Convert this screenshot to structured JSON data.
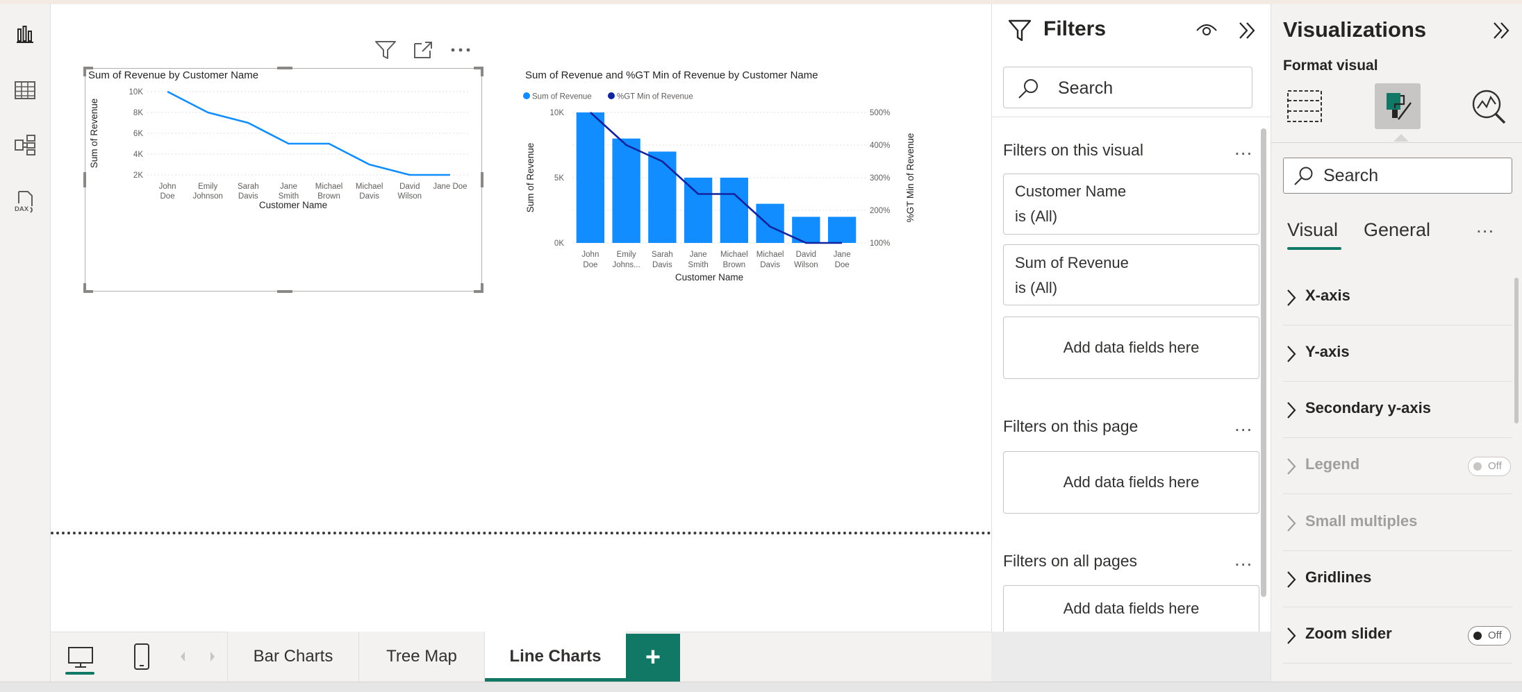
{
  "visual1": {
    "title": "Sum of Revenue by Customer Name",
    "y_ticks": [
      "10K",
      "8K",
      "6K",
      "4K",
      "2K"
    ],
    "x_lines": [
      [
        "John",
        "Doe"
      ],
      [
        "Emily",
        "Johnson"
      ],
      [
        "Sarah",
        "Davis"
      ],
      [
        "Jane",
        "Smith"
      ],
      [
        "Michael",
        "Brown"
      ],
      [
        "Michael",
        "Davis"
      ],
      [
        "David",
        "Wilson"
      ],
      [
        "Jane Doe",
        ""
      ]
    ],
    "xlabel": "Customer Name",
    "ylabel": "Sum of Revenue"
  },
  "visual2": {
    "title": "Sum of Revenue and %GT Min of Revenue by Customer Name",
    "legend": [
      "Sum of Revenue",
      "%GT Min of Revenue"
    ],
    "y_ticks": [
      "10K",
      "5K",
      "0K"
    ],
    "y2_ticks": [
      "500%",
      "400%",
      "300%",
      "200%",
      "100%"
    ],
    "x_lines": [
      [
        "John",
        "Doe"
      ],
      [
        "Emily",
        "Johns..."
      ],
      [
        "Sarah",
        "Davis"
      ],
      [
        "Jane",
        "Smith"
      ],
      [
        "Michael",
        "Brown"
      ],
      [
        "Michael",
        "Davis"
      ],
      [
        "David",
        "Wilson"
      ],
      [
        "Jane",
        "Doe"
      ]
    ],
    "xlabel": "Customer Name",
    "ylabel": "Sum of Revenue",
    "y2label": "%GT Min of Revenue"
  },
  "chart_data": [
    {
      "type": "line",
      "title": "Sum of Revenue by Customer Name",
      "categories": [
        "John Doe",
        "Emily Johnson",
        "Sarah Davis",
        "Jane Smith",
        "Michael Brown",
        "Michael Davis",
        "David Wilson",
        "Jane Doe"
      ],
      "series": [
        {
          "name": "Sum of Revenue",
          "values": [
            10000,
            8000,
            7000,
            5000,
            5000,
            3000,
            2000,
            2000
          ]
        }
      ],
      "xlabel": "Customer Name",
      "ylabel": "Sum of Revenue",
      "ylim": [
        2000,
        10000
      ],
      "grid": true,
      "color": "#118dff"
    },
    {
      "type": "bar",
      "title": "Sum of Revenue and %GT Min of Revenue by Customer Name",
      "categories": [
        "John Doe",
        "Emily Johns...",
        "Sarah Davis",
        "Jane Smith",
        "Michael Brown",
        "Michael Davis",
        "David Wilson",
        "Jane Doe"
      ],
      "series": [
        {
          "name": "Sum of Revenue",
          "type": "bar",
          "values": [
            10000,
            8000,
            7000,
            5000,
            5000,
            3000,
            2000,
            2000
          ],
          "color": "#118dff"
        },
        {
          "name": "%GT Min of Revenue",
          "type": "line",
          "axis": "secondary",
          "values": [
            500,
            400,
            350,
            250,
            250,
            150,
            100,
            100
          ],
          "color": "#12239e"
        }
      ],
      "xlabel": "Customer Name",
      "ylabel": "Sum of Revenue",
      "y2label": "%GT Min of Revenue",
      "ylim": [
        0,
        10000
      ],
      "y2lim": [
        100,
        500
      ],
      "legend": "top-left",
      "grid": true
    }
  ],
  "filters": {
    "title": "Filters",
    "search_placeholder": "Search",
    "on_visual_label": "Filters on this visual",
    "on_page_label": "Filters on this page",
    "on_all_label": "Filters on all pages",
    "more": "...",
    "cards": [
      {
        "field": "Customer Name",
        "state": "is (All)"
      },
      {
        "field": "Sum of Revenue",
        "state": "is (All)"
      }
    ],
    "add_fields": "Add data fields here"
  },
  "viz": {
    "title": "Visualizations",
    "format_label": "Format visual",
    "search_placeholder": "Search",
    "tab_visual": "Visual",
    "tab_general": "General",
    "more": "...",
    "sections": [
      {
        "label": "X-axis"
      },
      {
        "label": "Y-axis"
      },
      {
        "label": "Secondary y-axis"
      },
      {
        "label": "Legend",
        "toggle": "Off",
        "disabled": true
      },
      {
        "label": "Small multiples",
        "disabled": true
      },
      {
        "label": "Gridlines"
      },
      {
        "label": "Zoom slider",
        "toggle": "Off"
      }
    ]
  },
  "pages": {
    "tabs": [
      "Bar Charts",
      "Tree Map",
      "Line Charts"
    ],
    "active": "Line Charts",
    "add_label": "+"
  },
  "colors": {
    "accent": "#117865",
    "series1": "#118dff",
    "series2": "#12239e"
  }
}
